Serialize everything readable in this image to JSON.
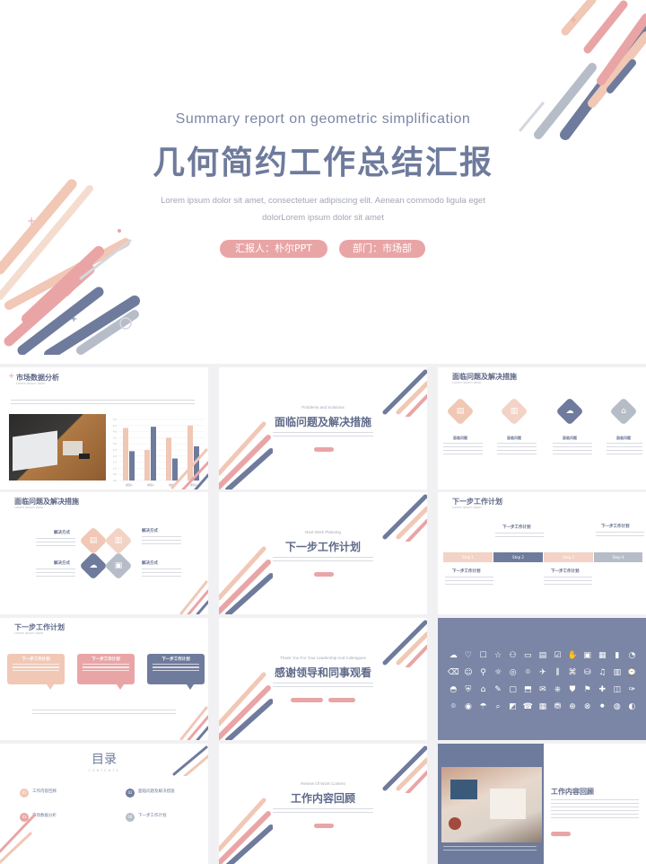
{
  "cover": {
    "subtitle_en": "Summary report on geometric simplification",
    "title": "几何简约工作总结汇报",
    "desc_line1": "Lorem ipsum dolor sit amet, consectetuer adipiscing elit. Aenean commodo ligula eget",
    "desc_line2": "dolorLorem ipsum dolor sit amet",
    "reporter": "汇报人：朴尔PPT",
    "department": "部门：市场部"
  },
  "colors": {
    "blue": "#6e7b9c",
    "pink": "#e9a5a6",
    "peach": "#f1c7b5",
    "grey": "#b6bdc9"
  },
  "slides": {
    "s1": {
      "title": "市场数据分析",
      "chart_data": {
        "type": "bar",
        "categories": [
          "类别1",
          "类别2",
          "类别3",
          "类别4"
        ],
        "series": [
          {
            "values": [
              4.3,
              2.5,
              3.5,
              4.5
            ]
          },
          {
            "values": [
              2.4,
              4.4,
              1.8,
              2.8
            ]
          }
        ],
        "ylim": [
          0,
          5
        ]
      }
    },
    "s2": {
      "en": "Problems and Solutions",
      "cn": "面临问题及解决措施"
    },
    "s3": {
      "title": "面临问题及解决措施",
      "items": [
        "面临问题",
        "面临问题",
        "面临问题",
        "面临问题"
      ]
    },
    "s4": {
      "title": "面临问题及解决措施",
      "labels": [
        "解决方式",
        "解决方式",
        "解决方式",
        "解决方式"
      ]
    },
    "s5": {
      "en": "Next Work Planning",
      "cn": "下一步工作计划"
    },
    "s6": {
      "title": "下一步工作计划",
      "plan_label": "下一步工作计划",
      "steps": [
        "Step 1",
        "Step 2",
        "Step 3",
        "Step 4"
      ]
    },
    "s7": {
      "title": "下一步工作计划",
      "bubbles": [
        "下一步工作计划",
        "下一步工作计划",
        "下一步工作计划"
      ]
    },
    "s8": {
      "en": "Thank You For Your Leadership And Colleagues",
      "cn": "感谢领导和同事观看"
    },
    "s9": {
      "icons": [
        "☁",
        "♡",
        "☐",
        "☆",
        "⚇",
        "▭",
        "▤",
        "☑",
        "✋",
        "▣",
        "▦",
        "▮",
        "◔",
        "⌫",
        "☺",
        "⚲",
        "☼",
        "◎",
        "⌾",
        "✈",
        "⫼",
        "⌘",
        "⛁",
        "♫",
        "▥",
        "⌚",
        "◓",
        "⛨",
        "⌂",
        "✎",
        "▢",
        "⬒",
        "✉",
        "⎈",
        "⛊",
        "⚑",
        "✚",
        "◫",
        "✑",
        "⌾",
        "◉",
        "☂",
        "⌕",
        "◩",
        "☎",
        "▦",
        "⛃",
        "⊕",
        "⊗",
        "⚫",
        "◍",
        "◐"
      ]
    },
    "s10": {
      "title": "目录",
      "en": "CONTENTS",
      "items": [
        {
          "num": "01",
          "label": "工作内容回顾"
        },
        {
          "num": "02",
          "label": "面临问题及解决措施"
        },
        {
          "num": "03",
          "label": "市场数据分析"
        },
        {
          "num": "04",
          "label": "下一步工作计划"
        }
      ]
    },
    "s11": {
      "en": "Review Of Work Content",
      "cn": "工作内容回顾"
    },
    "s12": {
      "title": "工作内容回顾"
    }
  }
}
